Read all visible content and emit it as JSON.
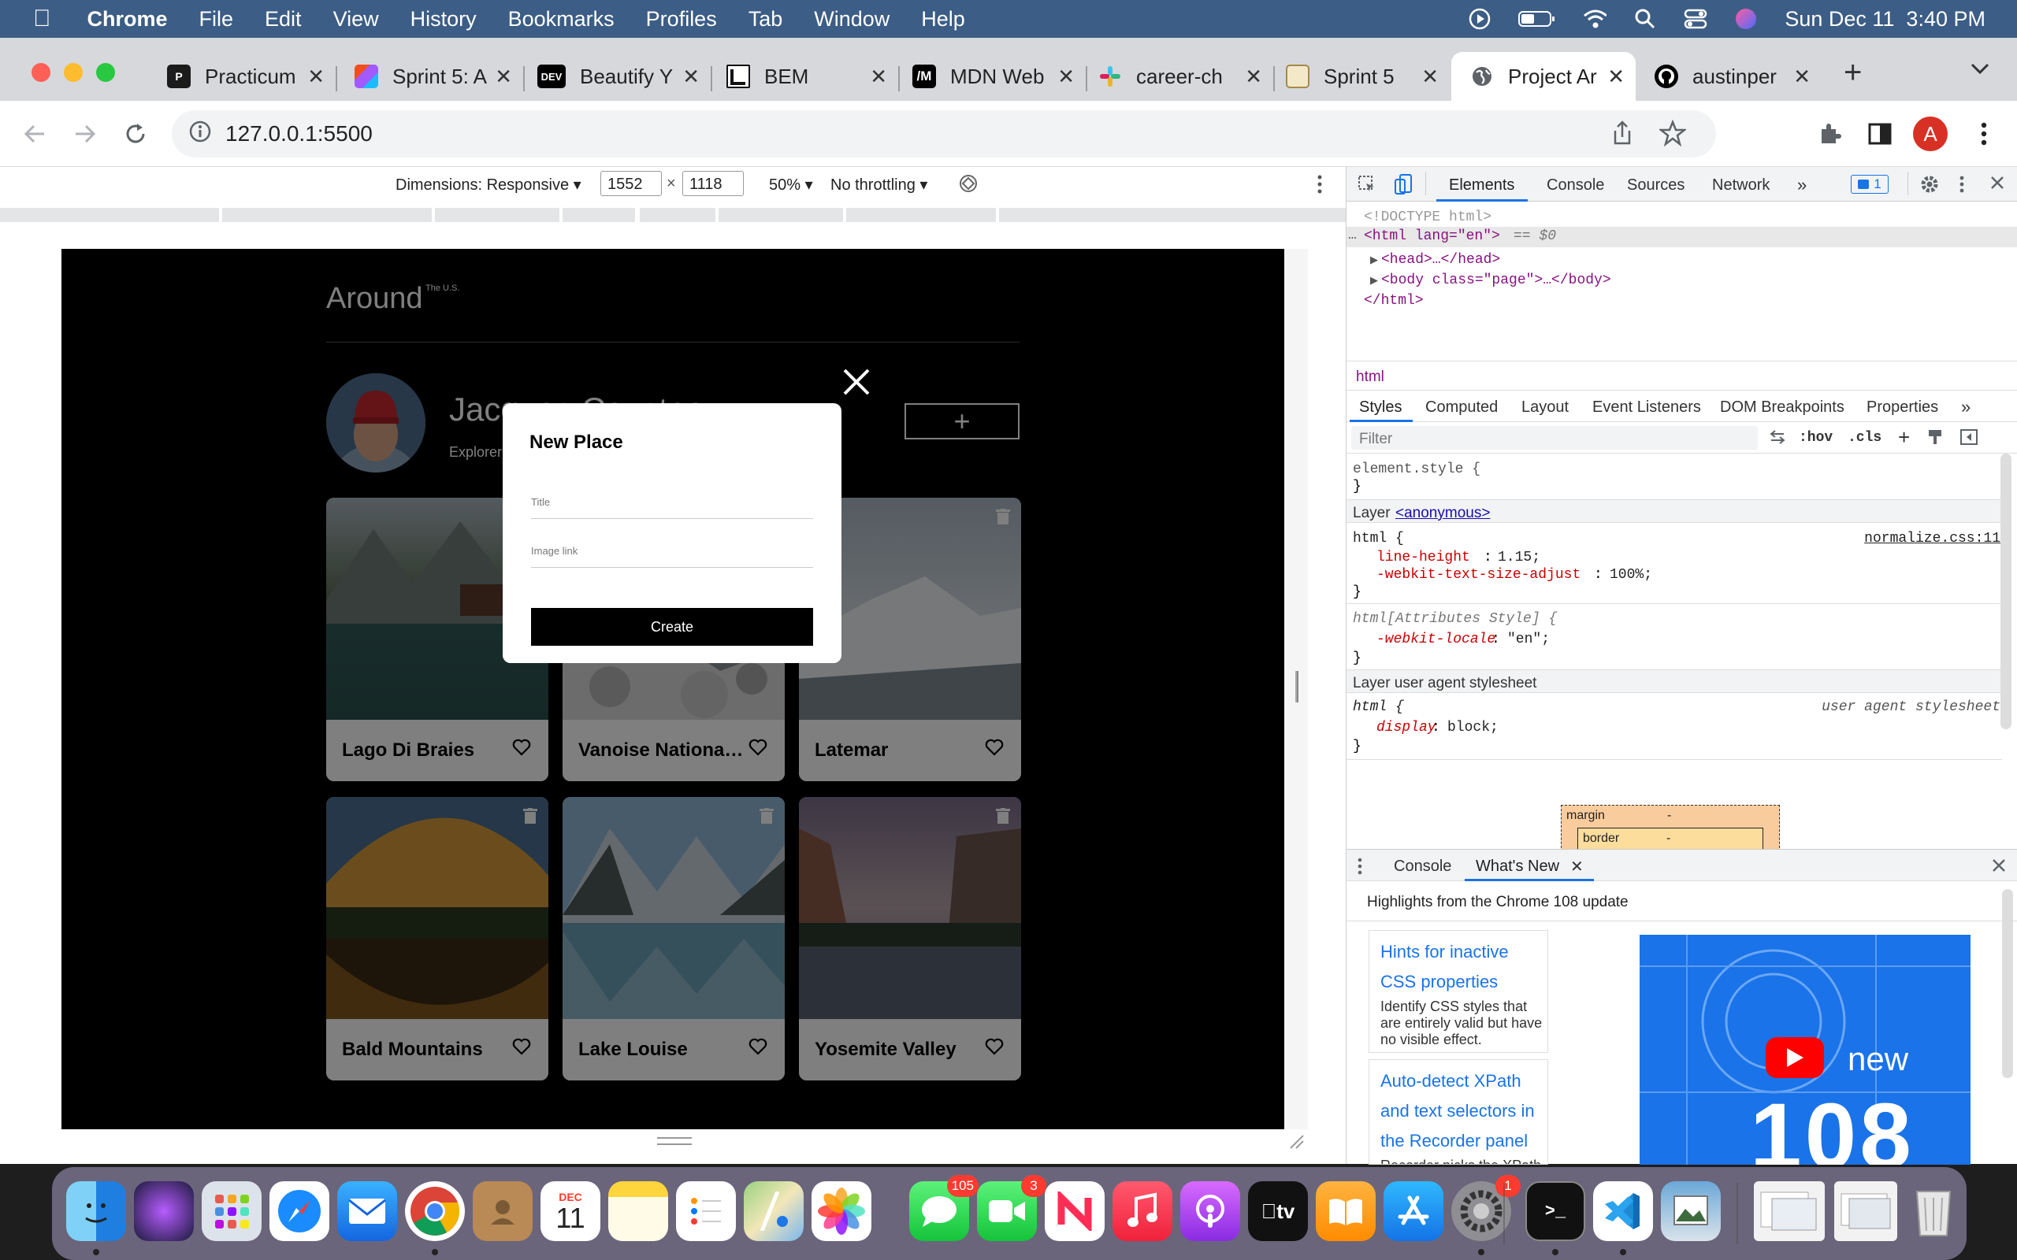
{
  "menubar": {
    "items": [
      "Chrome",
      "File",
      "Edit",
      "View",
      "History",
      "Bookmarks",
      "Profiles",
      "Tab",
      "Window",
      "Help"
    ],
    "datetime": "Sun Dec 11  3:40 PM"
  },
  "tabs": [
    {
      "title": "Practicum",
      "favicon": "P"
    },
    {
      "title": "Sprint 5: A",
      "favicon": "F"
    },
    {
      "title": "Beautify Y",
      "favicon": "DEV"
    },
    {
      "title": "BEM",
      "favicon": "B"
    },
    {
      "title": "MDN Web",
      "favicon": "M"
    },
    {
      "title": "career-ch",
      "favicon": "S"
    },
    {
      "title": "Sprint 5",
      "favicon": "N"
    },
    {
      "title": "Project Ar",
      "favicon": "G"
    },
    {
      "title": "austinper",
      "favicon": "GH"
    }
  ],
  "address": {
    "url": "127.0.0.1:5500"
  },
  "profile_initial": "A",
  "device_toolbar": {
    "dimensions": "Dimensions: Responsive ▾",
    "width": "1552",
    "height": "1118",
    "times": "×",
    "zoom": "50% ▾",
    "throttling": "No throttling ▾"
  },
  "page": {
    "logo": "Around",
    "logo_sup": "The U.S.",
    "profile_name": "Jacques Cousteau",
    "profile_about": "Explorer",
    "add_button": "+",
    "cards": [
      {
        "name": "Lago Di Braies"
      },
      {
        "name": "Vanoise National Park"
      },
      {
        "name": "Latemar"
      },
      {
        "name": "Bald Mountains"
      },
      {
        "name": "Lake Louise"
      },
      {
        "name": "Yosemite Valley"
      }
    ],
    "modal": {
      "title": "New Place",
      "title_placeholder": "Title",
      "link_placeholder": "Image link",
      "submit": "Create"
    }
  },
  "devtools": {
    "tabs": [
      "Elements",
      "Console",
      "Sources",
      "Network",
      "»"
    ],
    "issues_count": "1",
    "dom": {
      "doctype": "<!DOCTYPE html>",
      "html_open": "<html lang=\"en\">",
      "html_sel": "== $0",
      "head": "<head>…</head>",
      "body": "<body class=\"page\">…</body>",
      "html_close": "</html>"
    },
    "breadcrumb": "html",
    "style_tabs": [
      "Styles",
      "Computed",
      "Layout",
      "Event Listeners",
      "DOM Breakpoints",
      "Properties",
      "»"
    ],
    "filter_placeholder": "Filter",
    "filter_tools": [
      ":hov",
      ".cls",
      "+"
    ],
    "rules": {
      "element_style": "element.style {",
      "close": "}",
      "layer_anon_label": "Layer",
      "layer_anon_link": "<anonymous>",
      "html_rule": "html {",
      "normalize_src": "normalize.css:11",
      "line_height_prop": "line-height",
      "line_height_val": "1.15;",
      "text_adjust_prop": "-webkit-text-size-adjust",
      "text_adjust_val": "100%;",
      "attr_style": "html[Attributes Style] {",
      "locale_prop": "-webkit-locale",
      "locale_val": "\"en\";",
      "layer_ua": "Layer user agent stylesheet",
      "ua_src": "user agent stylesheet",
      "display_prop": "display",
      "display_val": "block;"
    },
    "boxmodel": {
      "margin": "margin",
      "border": "border",
      "dash": "-"
    },
    "drawer": {
      "tabs": [
        "Console",
        "What's New"
      ],
      "highlight": "Highlights from the Chrome 108 update",
      "items": [
        {
          "title": "Hints for inactive CSS properties",
          "desc": "Identify CSS styles that are entirely valid but have no visible effect."
        },
        {
          "title": "Auto-detect XPath and text selectors in the Recorder panel",
          "desc": "Recorder picks the XPath"
        }
      ],
      "video_text": "new",
      "video_num": "108"
    }
  },
  "dock": {
    "badges": {
      "messages": "105",
      "facetime": "3",
      "settings": "1"
    },
    "calendar_month": "DEC",
    "calendar_day": "11"
  }
}
